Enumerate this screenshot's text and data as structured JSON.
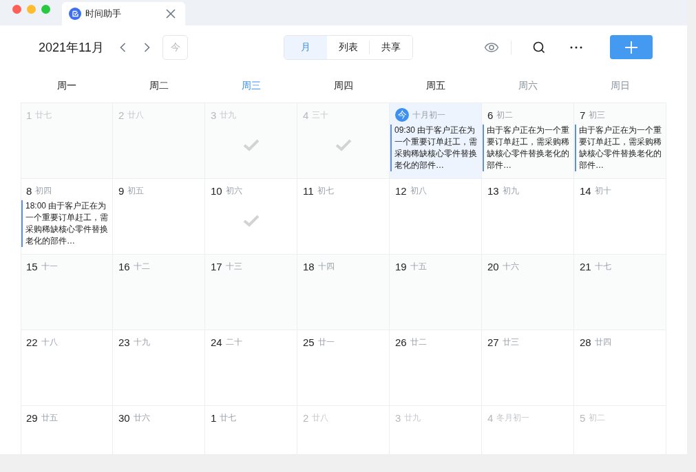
{
  "tab": {
    "title": "时间助手"
  },
  "toolbar": {
    "month_title": "2021年11月",
    "today_button": "今",
    "views": [
      {
        "label": "月",
        "selected": true
      },
      {
        "label": "列表",
        "selected": false
      },
      {
        "label": "共享",
        "selected": false
      }
    ]
  },
  "weekdays": [
    {
      "label": "周一",
      "kind": "normal"
    },
    {
      "label": "周二",
      "kind": "normal"
    },
    {
      "label": "周三",
      "kind": "current"
    },
    {
      "label": "周四",
      "kind": "normal"
    },
    {
      "label": "周五",
      "kind": "normal"
    },
    {
      "label": "周六",
      "kind": "weekend"
    },
    {
      "label": "周日",
      "kind": "weekend"
    }
  ],
  "weeks": [
    [
      {
        "day": "1",
        "lunar": "廿七",
        "dimmed": true,
        "done": false,
        "today": false
      },
      {
        "day": "2",
        "lunar": "廿八",
        "dimmed": true,
        "done": false,
        "today": false
      },
      {
        "day": "3",
        "lunar": "廿九",
        "dimmed": true,
        "done": true,
        "today": false
      },
      {
        "day": "4",
        "lunar": "三十",
        "dimmed": true,
        "done": true,
        "today": false
      },
      {
        "day": "今",
        "lunar": "十月初一",
        "dimmed": false,
        "done": false,
        "today": true,
        "events": [
          "09:30 由于客户正在为一个重要订单赶工，需采购稀缺核心零件替换老化的部件…"
        ]
      },
      {
        "day": "6",
        "lunar": "初二",
        "dimmed": false,
        "done": false,
        "today": false,
        "events": [
          "由于客户正在为一个重要订单赶工，需采购稀缺核心零件替换老化的部件…"
        ]
      },
      {
        "day": "7",
        "lunar": "初三",
        "dimmed": false,
        "done": false,
        "today": false,
        "events": [
          "由于客户正在为一个重要订单赶工，需采购稀缺核心零件替换老化的部件…"
        ]
      }
    ],
    [
      {
        "day": "8",
        "lunar": "初四",
        "dimmed": false,
        "done": false,
        "today": false,
        "events": [
          "18:00 由于客户正在为一个重要订单赶工，需采购稀缺核心零件替换老化的部件…"
        ]
      },
      {
        "day": "9",
        "lunar": "初五",
        "dimmed": false,
        "done": false,
        "today": false
      },
      {
        "day": "10",
        "lunar": "初六",
        "dimmed": false,
        "done": true,
        "today": false
      },
      {
        "day": "11",
        "lunar": "初七",
        "dimmed": false,
        "done": false,
        "today": false
      },
      {
        "day": "12",
        "lunar": "初八",
        "dimmed": false,
        "done": false,
        "today": false
      },
      {
        "day": "13",
        "lunar": "初九",
        "dimmed": false,
        "done": false,
        "today": false
      },
      {
        "day": "14",
        "lunar": "初十",
        "dimmed": false,
        "done": false,
        "today": false
      }
    ],
    [
      {
        "day": "15",
        "lunar": "十一",
        "dimmed": false,
        "done": false,
        "today": false
      },
      {
        "day": "16",
        "lunar": "十二",
        "dimmed": false,
        "done": false,
        "today": false
      },
      {
        "day": "17",
        "lunar": "十三",
        "dimmed": false,
        "done": false,
        "today": false
      },
      {
        "day": "18",
        "lunar": "十四",
        "dimmed": false,
        "done": false,
        "today": false
      },
      {
        "day": "19",
        "lunar": "十五",
        "dimmed": false,
        "done": false,
        "today": false
      },
      {
        "day": "20",
        "lunar": "十六",
        "dimmed": false,
        "done": false,
        "today": false
      },
      {
        "day": "21",
        "lunar": "十七",
        "dimmed": false,
        "done": false,
        "today": false
      }
    ],
    [
      {
        "day": "22",
        "lunar": "十八",
        "dimmed": false,
        "done": false,
        "today": false
      },
      {
        "day": "23",
        "lunar": "十九",
        "dimmed": false,
        "done": false,
        "today": false
      },
      {
        "day": "24",
        "lunar": "二十",
        "dimmed": false,
        "done": false,
        "today": false
      },
      {
        "day": "25",
        "lunar": "廿一",
        "dimmed": false,
        "done": false,
        "today": false
      },
      {
        "day": "26",
        "lunar": "廿二",
        "dimmed": false,
        "done": false,
        "today": false
      },
      {
        "day": "27",
        "lunar": "廿三",
        "dimmed": false,
        "done": false,
        "today": false
      },
      {
        "day": "28",
        "lunar": "廿四",
        "dimmed": false,
        "done": false,
        "today": false
      }
    ],
    [
      {
        "day": "29",
        "lunar": "廿五",
        "dimmed": false,
        "done": false,
        "today": false
      },
      {
        "day": "30",
        "lunar": "廿六",
        "dimmed": false,
        "done": false,
        "today": false
      },
      {
        "day": "1",
        "lunar": "廿七",
        "dimmed": false,
        "done": false,
        "today": false
      },
      {
        "day": "2",
        "lunar": "廿八",
        "dimmed": true,
        "done": false,
        "today": false
      },
      {
        "day": "3",
        "lunar": "廿九",
        "dimmed": true,
        "done": false,
        "today": false
      },
      {
        "day": "4",
        "lunar": "冬月初一",
        "dimmed": true,
        "done": false,
        "today": false
      },
      {
        "day": "5",
        "lunar": "初二",
        "dimmed": true,
        "done": false,
        "today": false
      }
    ]
  ]
}
